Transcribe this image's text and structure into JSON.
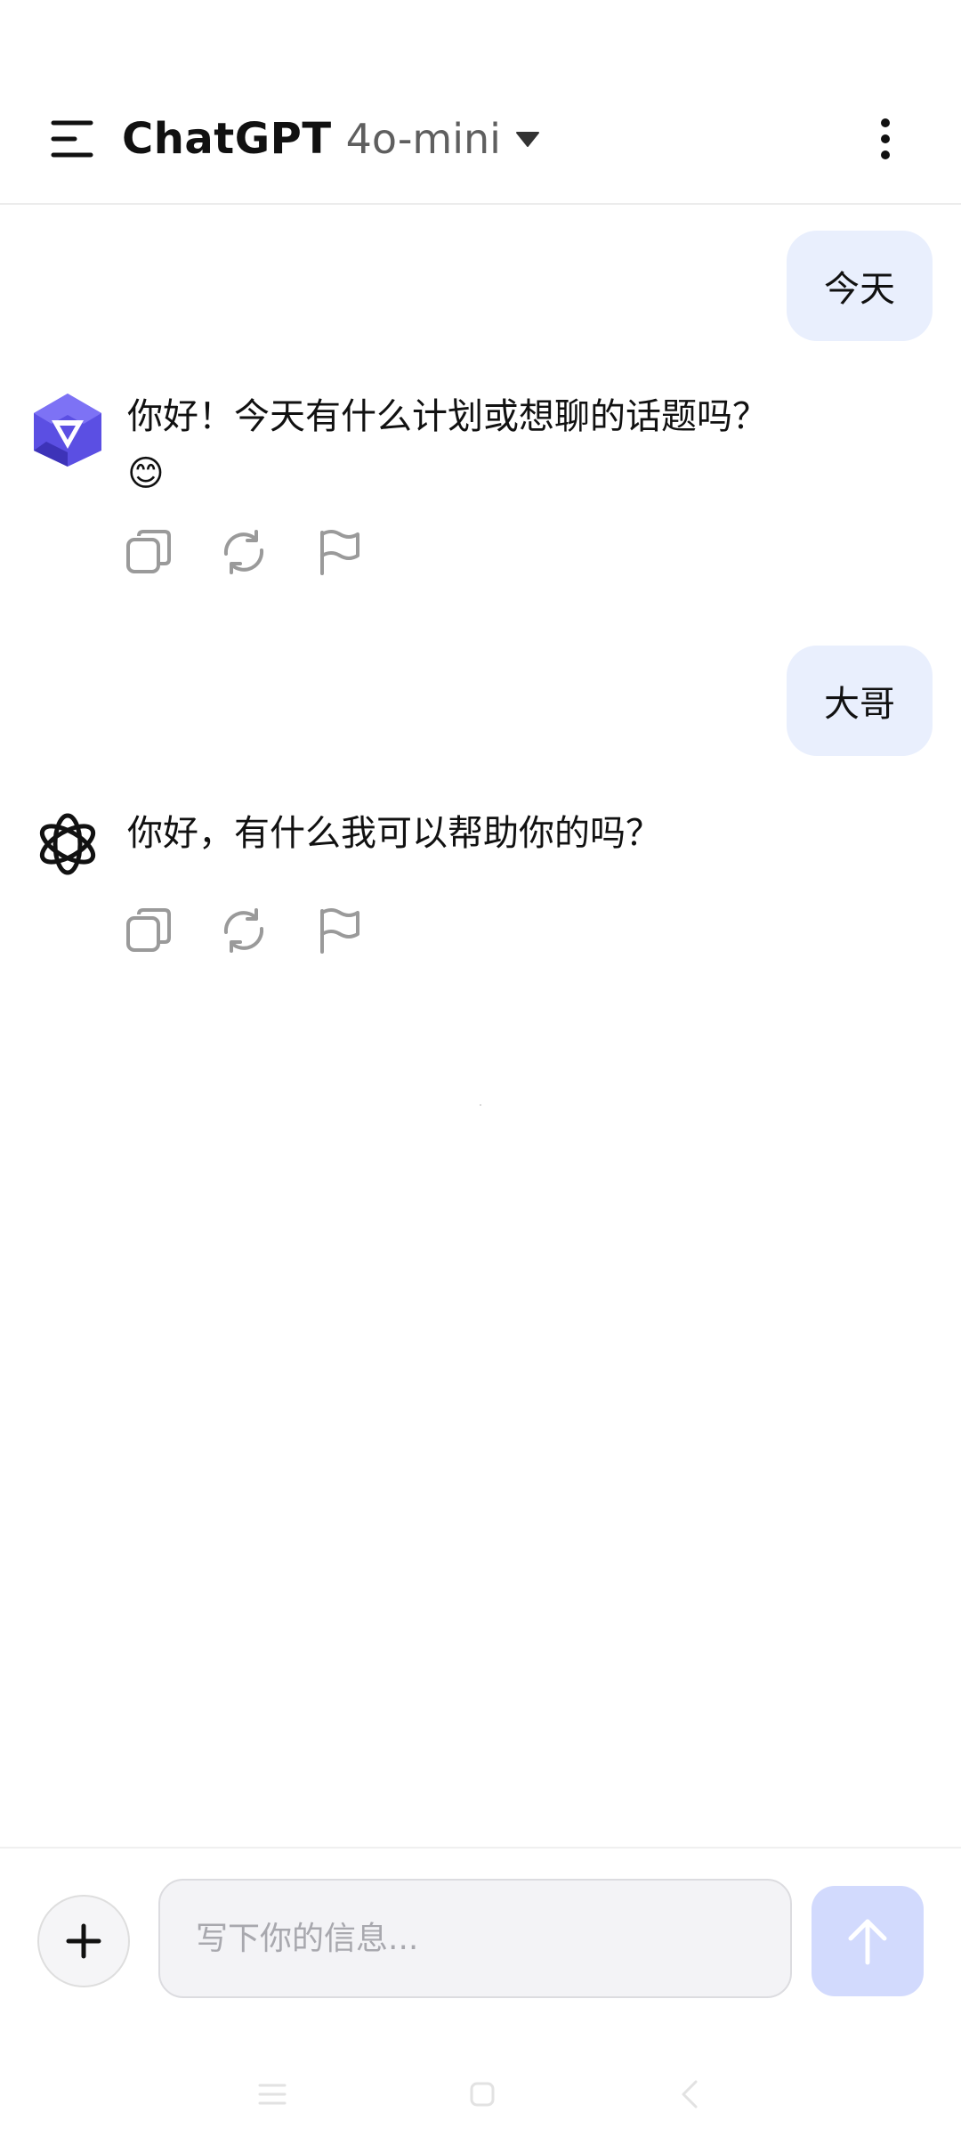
{
  "header": {
    "app_name": "ChatGPT",
    "model_name": "4o-mini",
    "menu_icon": "menu-icon",
    "more_icon": "more-vertical-icon",
    "caret_icon": "caret-down-icon"
  },
  "conversation": [
    {
      "role": "user",
      "text": "今天"
    },
    {
      "role": "assistant",
      "avatar": "qwen-logo-icon",
      "text": "你好！今天有什么计划或想聊的话题吗？",
      "emoji": "😊",
      "actions": [
        "copy-icon",
        "regenerate-icon",
        "flag-icon"
      ]
    },
    {
      "role": "user",
      "text": "大哥"
    },
    {
      "role": "assistant",
      "avatar": "openai-logo-icon",
      "text": "你好，有什么我可以帮助你的吗？",
      "actions": [
        "copy-icon",
        "regenerate-icon",
        "flag-icon"
      ]
    }
  ],
  "composer": {
    "placeholder": "写下你的信息...",
    "value": "",
    "add_icon": "plus-icon",
    "send_icon": "arrow-up-icon"
  },
  "nav_bar": {
    "icons": [
      "menu-lines-icon",
      "home-square-icon",
      "back-chevron-icon"
    ]
  },
  "colors": {
    "user_bubble": "#e9effd",
    "send_button": "#d2dafd",
    "qwen_purple": "#6a5cf0",
    "icon_gray": "#9a9a9a"
  }
}
